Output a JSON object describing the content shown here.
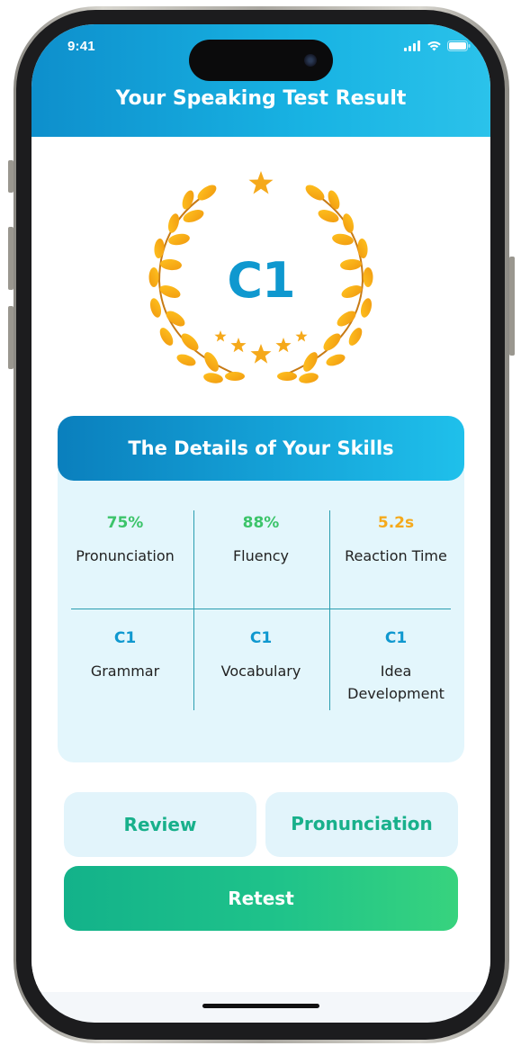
{
  "status_bar": {
    "time": "9:41",
    "icons": [
      "cellular-signal-icon",
      "wifi-icon",
      "battery-icon"
    ]
  },
  "header": {
    "title": "Your Speaking Test Result"
  },
  "result": {
    "level": "C1",
    "decoration": "laurel-wreath-with-stars-icon"
  },
  "details": {
    "title": "The Details of Your Skills",
    "skills": [
      {
        "value": "75%",
        "label": "Pronunciation",
        "color": "#3cc46a"
      },
      {
        "value": "88%",
        "label": "Fluency",
        "color": "#3cc46a"
      },
      {
        "value": "5.2s",
        "label": "Reaction Time",
        "color": "#f5a91b"
      },
      {
        "value": "C1",
        "label": "Grammar",
        "color": "#0f98cf"
      },
      {
        "value": "C1",
        "label": "Vocabulary",
        "color": "#0f98cf"
      },
      {
        "value": "C1",
        "label_line1": "Idea",
        "label_line2": "Development",
        "color": "#0f98cf"
      }
    ]
  },
  "actions": {
    "review_label": "Review",
    "pronunciation_label": "Pronunciation",
    "retest_label": "Retest"
  },
  "colors": {
    "header_gradient_start": "#0e8fcc",
    "header_gradient_end": "#2bc2ea",
    "accent_green": "#18b08b",
    "gold": "#f5a91b",
    "level_blue": "#0f98cf"
  }
}
